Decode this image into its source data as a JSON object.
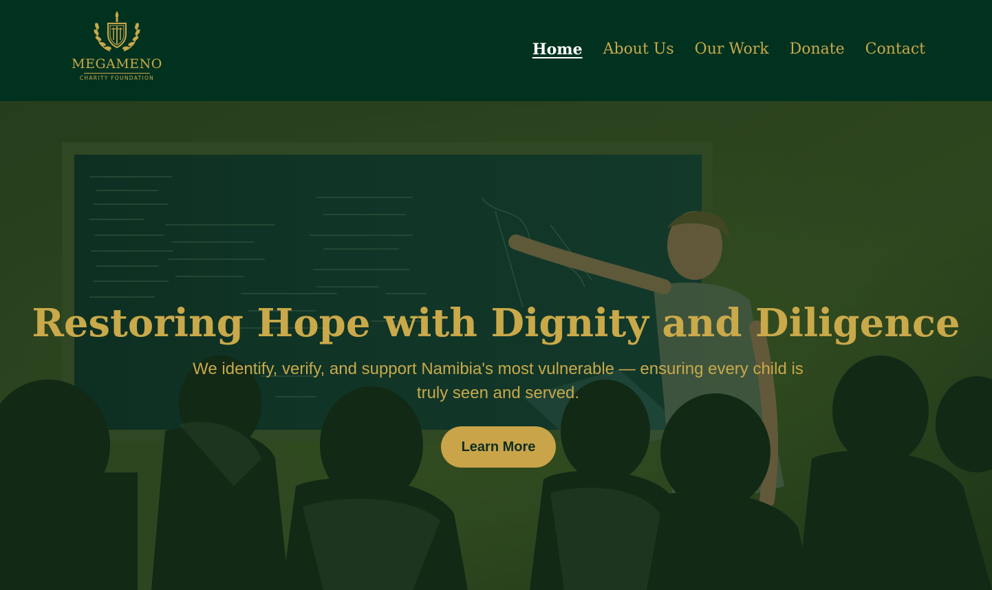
{
  "brand": {
    "name": "MEGAMENO",
    "tagline": "CHARITY FOUNDATION",
    "emblem_icon": "laurel-shield-icon",
    "gold": "#c9a94a",
    "green": "#013220"
  },
  "nav": {
    "items": [
      {
        "label": "Home",
        "active": true
      },
      {
        "label": "About Us",
        "active": false
      },
      {
        "label": "Our Work",
        "active": false
      },
      {
        "label": "Donate",
        "active": false
      },
      {
        "label": "Contact",
        "active": false
      }
    ]
  },
  "hero": {
    "title": "Restoring Hope with Dignity and Diligence",
    "subtitle": "We identify, verify, and support Namibia's most vulnerable — ensuring every child is truly seen and served.",
    "cta_label": "Learn More"
  }
}
